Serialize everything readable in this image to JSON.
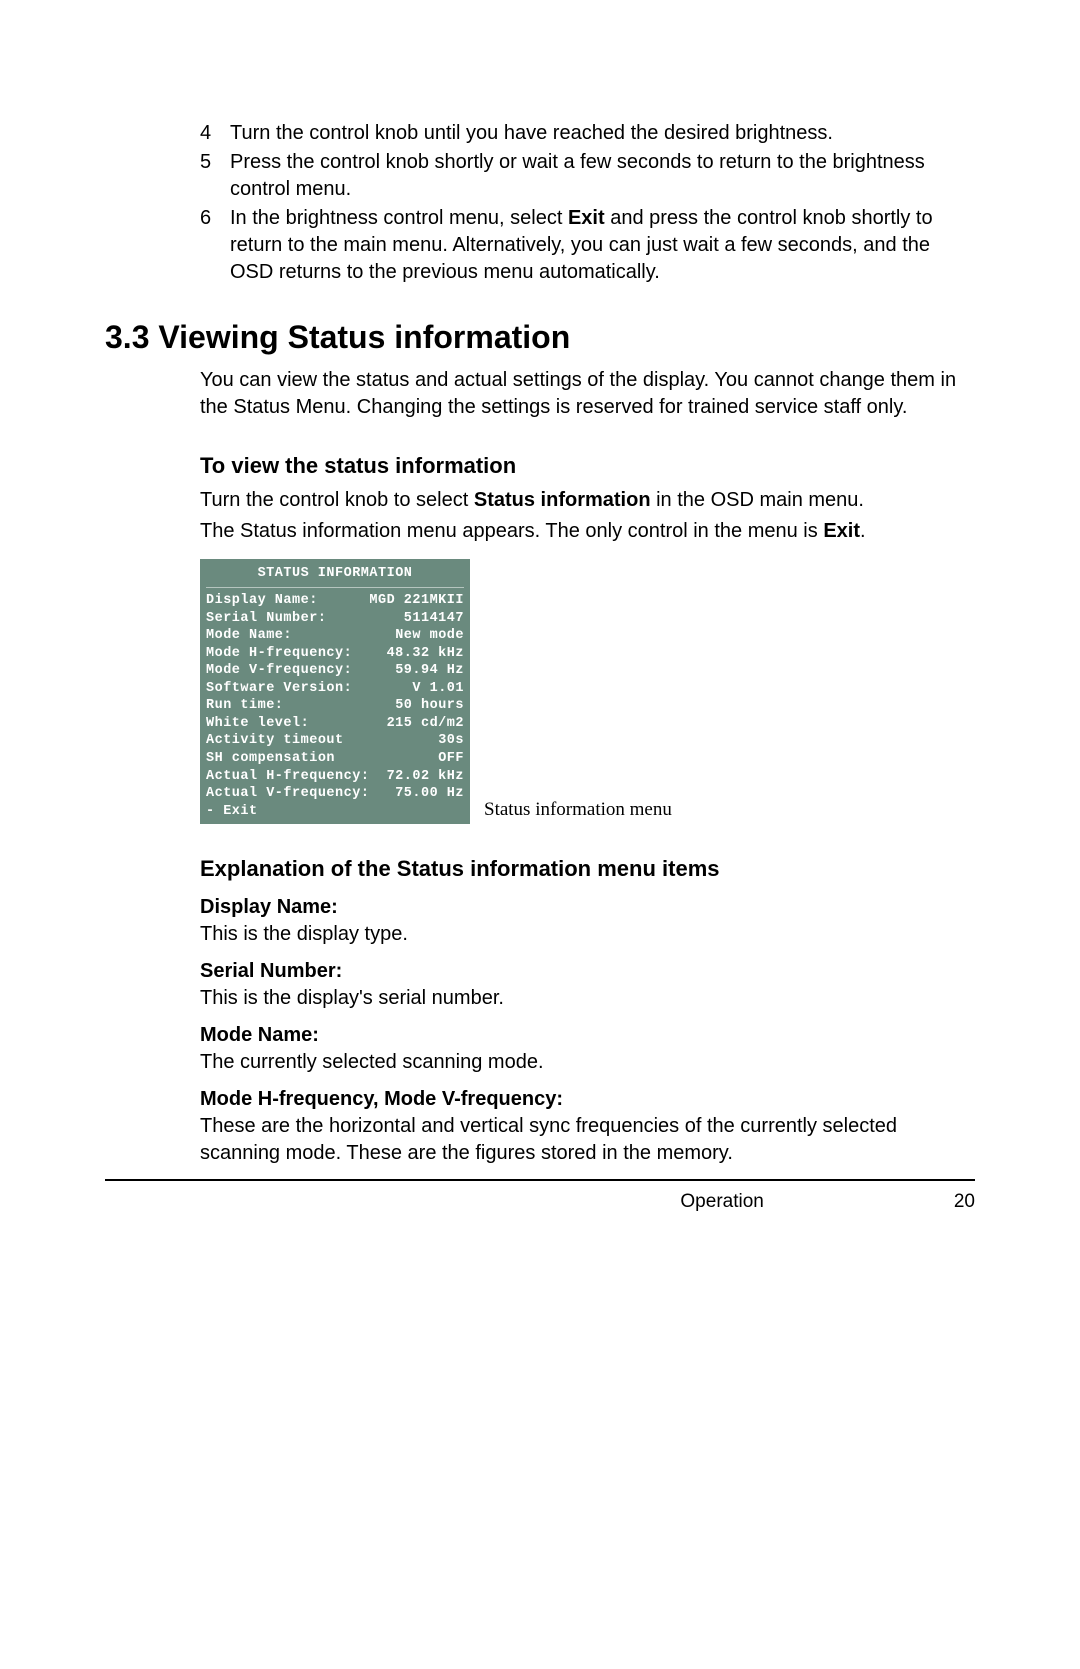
{
  "steps": [
    {
      "n": "4",
      "text": "Turn the control knob until you have reached the desired brightness."
    },
    {
      "n": "5",
      "text": "Press the control knob shortly or wait a few seconds to return to the brightness control menu."
    },
    {
      "n": "6",
      "before": "In the brightness control menu, select ",
      "bold": "Exit",
      "after": " and press the control knob shortly to return to the main menu. Alternatively, you can just wait a few seconds, and the OSD returns to the previous menu automatically."
    }
  ],
  "section_title": "3.3 Viewing Status information",
  "intro": "You can view the status and actual settings of the display. You cannot change them in the Status Menu. Changing the settings is reserved for trained service staff only.",
  "how_heading": "To view the status information",
  "how_p1_before": "Turn the control knob to select ",
  "how_p1_bold": "Status information",
  "how_p1_after": " in the OSD main menu.",
  "how_p2_before": "The Status information menu appears. The only control in the menu is ",
  "how_p2_bold": "Exit",
  "how_p2_after": ".",
  "menu": {
    "title": "STATUS INFORMATION",
    "rows": [
      {
        "l": "Display Name:",
        "r": "MGD 221MKII"
      },
      {
        "l": "Serial Number:",
        "r": "5114147"
      },
      {
        "l": "Mode Name:",
        "r": "New mode"
      },
      {
        "l": "Mode H-frequency:",
        "r": "48.32 kHz"
      },
      {
        "l": "Mode V-frequency:",
        "r": "59.94 Hz"
      },
      {
        "l": "Software Version:",
        "r": "V 1.01"
      },
      {
        "l": "Run time:",
        "r": "50 hours"
      },
      {
        "l": "White level:",
        "r": "215 cd/m2"
      },
      {
        "l": "Activity timeout",
        "r": "30s"
      },
      {
        "l": "SH compensation",
        "r": "OFF"
      },
      {
        "l": "Actual H-frequency:",
        "r": "72.02 kHz"
      },
      {
        "l": "Actual V-frequency:",
        "r": "75.00 Hz"
      }
    ],
    "exit": "- Exit"
  },
  "caption": "Status information menu",
  "expl_heading": "Explanation of the Status information menu items",
  "items": [
    {
      "label": "Display Name:",
      "desc": "This is the display type."
    },
    {
      "label": "Serial Number:",
      "desc": "This is the display's serial number."
    },
    {
      "label": "Mode Name:",
      "desc": "The currently selected scanning mode."
    },
    {
      "label": "Mode H-frequency, Mode V-frequency:",
      "desc": "These are the horizontal and vertical sync frequencies of the currently selected scanning mode. These are the figures stored in the memory."
    }
  ],
  "footer_center": "Operation",
  "footer_page": "20"
}
